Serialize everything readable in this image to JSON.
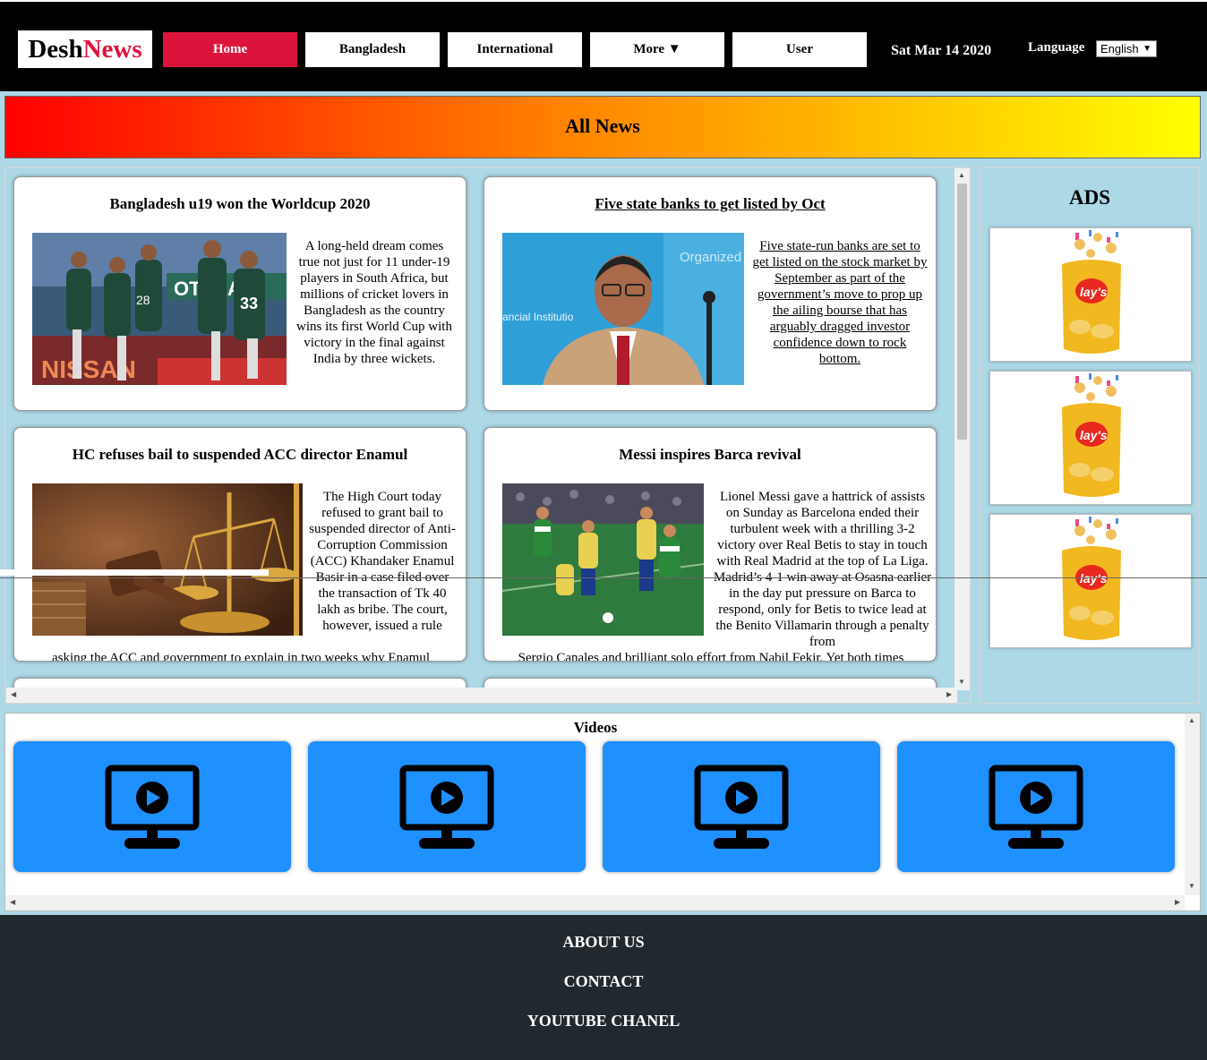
{
  "header": {
    "logo_part1": "Desh",
    "logo_part2": "News",
    "nav": [
      {
        "label": "Home",
        "active": true
      },
      {
        "label": "Bangladesh"
      },
      {
        "label": "International"
      },
      {
        "label": "More ▼"
      },
      {
        "label": "User"
      }
    ],
    "date": "Sat Mar 14 2020",
    "language_label": "Language",
    "language_value": "English"
  },
  "banner": {
    "title": "All News"
  },
  "news": [
    {
      "title": "Bangladesh u19 won the Worldcup 2020",
      "image": "cricket-team-photo",
      "text": "A long-held dream comes true not just for 11 under-19 players in South Africa, but millions of cricket lovers in Bangladesh as the country wins its first World Cup with victory in the final against India by three wickets."
    },
    {
      "title": "Five state banks to get listed by Oct",
      "image": "official-portrait-photo",
      "text": "Five state-run banks are set to get listed on the stock market by September as part of the government’s move to prop up the ailing bourse that has arguably dragged investor confidence down to rock bottom."
    },
    {
      "title": "HC refuses bail to suspended ACC director Enamul",
      "image": "gavel-scales-photo",
      "text": "The High Court today refused to grant bail to suspended director of Anti-Corruption Commission (ACC) Khandaker Enamul Basir in a case filed over the transaction of Tk 40 lakh as bribe. The court, however, issued a rule",
      "text_overflow": "asking the ACC and government to explain in two weeks why Enamul"
    },
    {
      "title": "Messi inspires Barca revival",
      "image": "football-match-photo",
      "text": "Lionel Messi gave a hattrick of assists on Sunday as Barcelona ended their turbulent week with a thrilling 3-2 victory over Real Betis to stay in touch with Real Madrid at the top of La Liga. Madrid’s 4-1 win away at Osasna earlier in the day put pressure on Barca to respond, only for Betis to twice lead at the Benito Villamarin through a penalty from",
      "text_overflow": "Sergio Canales and brilliant solo effort from Nabil Fekir. Yet both times"
    }
  ],
  "ads": {
    "title": "ADS",
    "items": [
      {
        "brand": "lay's",
        "image": "lays-chips-bag"
      },
      {
        "brand": "lay's",
        "image": "lays-chips-bag"
      },
      {
        "brand": "lay's",
        "image": "lays-chips-bag"
      }
    ]
  },
  "videos": {
    "title": "Videos",
    "count": 4,
    "icon": "monitor-play-icon",
    "color": "#1e90ff"
  },
  "footer": {
    "links": [
      "ABOUT US",
      "CONTACT",
      "YOUTUBE CHANEL"
    ]
  },
  "colors": {
    "accent": "#dc143c",
    "footer_bg": "#22292e",
    "panel_bg": "#add8e6"
  }
}
